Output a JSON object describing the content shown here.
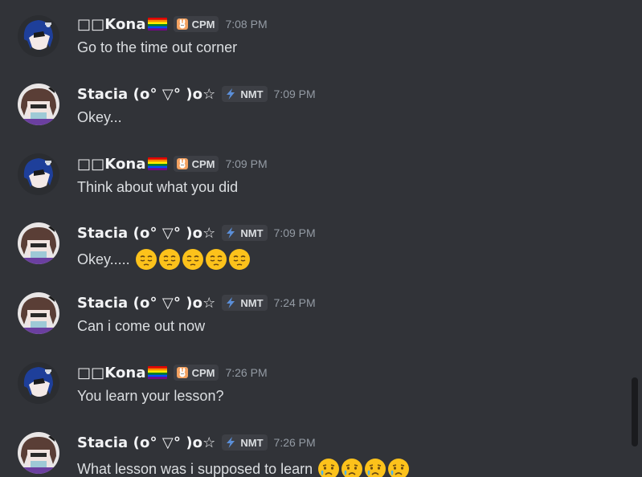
{
  "users": {
    "kona": {
      "name": "□□Kona",
      "flag": "rainbow-flag",
      "tag": "CPM",
      "tag_icon": "rabbit-face-icon",
      "tag_icon_color": "#f4a261"
    },
    "stacia": {
      "name": "Stacia (o° ▽° )o☆",
      "tag": "NMT",
      "tag_icon": "lightning-icon",
      "tag_icon_color": "#5b8fd9"
    }
  },
  "messages": [
    {
      "author": "□□Kona",
      "author_key": "kona",
      "time": "7:08 PM",
      "text": "Go to the time out corner",
      "emojis": []
    },
    {
      "author": "Stacia (o° ▽° )o☆",
      "author_key": "stacia",
      "time": "7:09 PM",
      "text": "Okey...",
      "emojis": []
    },
    {
      "author": "□□Kona",
      "author_key": "kona",
      "time": "7:09 PM",
      "text": "Think about what you did",
      "emojis": []
    },
    {
      "author": "Stacia (o° ▽° )o☆",
      "author_key": "stacia",
      "time": "7:09 PM",
      "text": "Okey.....",
      "emojis": [
        "pensive-face",
        "pensive-face",
        "pensive-face",
        "pensive-face",
        "pensive-face"
      ]
    },
    {
      "author": "Stacia (o° ▽° )o☆",
      "author_key": "stacia",
      "time": "7:24 PM",
      "text": "Can i come out now",
      "emojis": []
    },
    {
      "author": "□□Kona",
      "author_key": "kona",
      "time": "7:26 PM",
      "text": "You learn your lesson?",
      "emojis": []
    },
    {
      "author": "Stacia (o° ▽° )o☆",
      "author_key": "stacia",
      "time": "7:26 PM",
      "text": "What lesson was i supposed to learn",
      "emojis": [
        "crying-face",
        "crying-face",
        "crying-face",
        "crying-face"
      ]
    }
  ],
  "colors": {
    "background": "#313338",
    "username": "#f2f3f5",
    "message_text": "#dbdee1",
    "timestamp": "#949ba4",
    "tag_background": "#3d3f45"
  }
}
